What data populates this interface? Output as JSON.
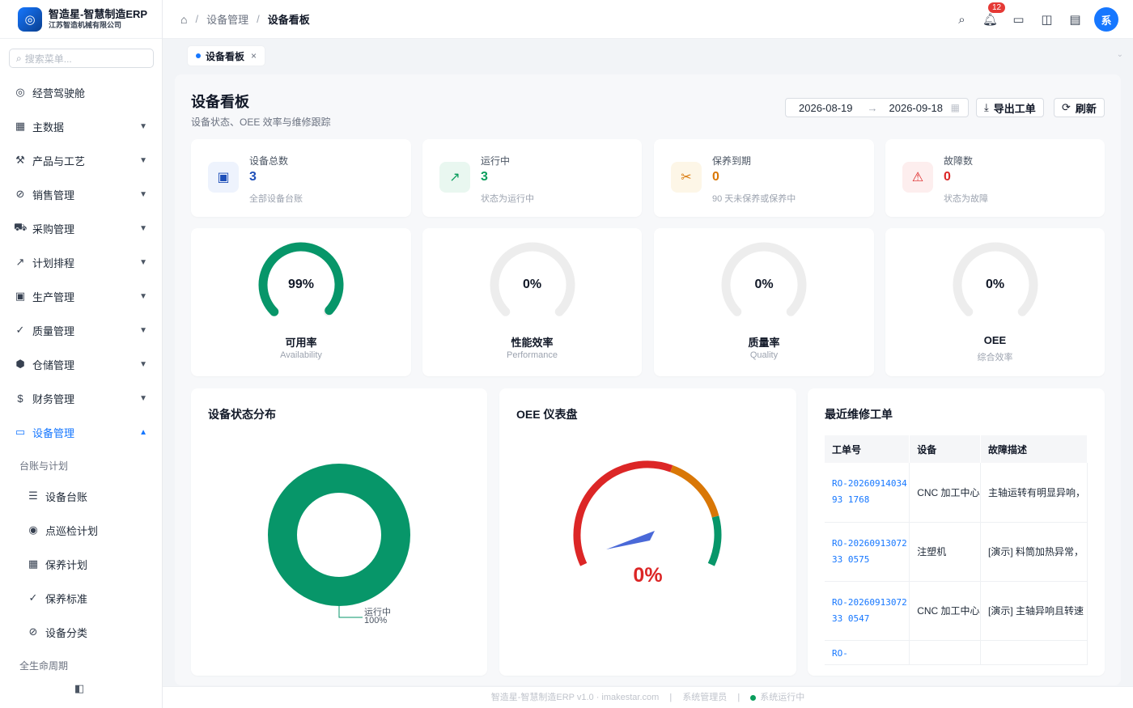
{
  "app": {
    "title": "智造星-智慧制造ERP",
    "company": "江苏智造机械有限公司",
    "logo_glyph": "◎"
  },
  "search": {
    "placeholder": "搜索菜单..."
  },
  "sidebar": {
    "items": [
      {
        "label": "经营驾驶舱",
        "icon": "◎"
      },
      {
        "label": "主数据",
        "icon": "▦"
      },
      {
        "label": "产品与工艺",
        "icon": "⚒"
      },
      {
        "label": "销售管理",
        "icon": "⊘"
      },
      {
        "label": "采购管理",
        "icon": "⛟"
      },
      {
        "label": "计划排程",
        "icon": "↗"
      },
      {
        "label": "生产管理",
        "icon": "▣"
      },
      {
        "label": "质量管理",
        "icon": "✓"
      },
      {
        "label": "仓储管理",
        "icon": "⬢"
      },
      {
        "label": "财务管理",
        "icon": "$"
      },
      {
        "label": "设备管理",
        "icon": "▭"
      }
    ],
    "group1": "台账与计划",
    "subitems": [
      {
        "label": "设备台账",
        "icon": "☰"
      },
      {
        "label": "点巡检计划",
        "icon": "◉"
      },
      {
        "label": "保养计划",
        "icon": "▦"
      },
      {
        "label": "保养标准",
        "icon": "✓"
      },
      {
        "label": "设备分类",
        "icon": "⊘"
      }
    ],
    "group2": "全生命周期"
  },
  "header": {
    "breadcrumb": [
      "设备管理",
      "设备看板"
    ],
    "notification_count": "12",
    "avatar": "系"
  },
  "tab": {
    "label": "设备看板",
    "close": "×"
  },
  "page": {
    "title": "设备看板",
    "subtitle": "设备状态、OEE 效率与维修跟踪"
  },
  "toolbar": {
    "date_start": "2026-08-19",
    "date_end": "2026-09-18",
    "export_label": "导出工单",
    "refresh_label": "刷新"
  },
  "kpis": [
    {
      "label": "设备总数",
      "value": "3",
      "desc": "全部设备台账",
      "color": "#1e4fb8",
      "bg": "#eef3fd",
      "icon": "▣"
    },
    {
      "label": "运行中",
      "value": "3",
      "desc": "状态为运行中",
      "color": "#0a9d5c",
      "bg": "#e9f7f0",
      "icon": "↗"
    },
    {
      "label": "保养到期",
      "value": "0",
      "desc": "90 天未保养或保养中",
      "color": "#d97706",
      "bg": "#fdf6e7",
      "icon": "✂"
    },
    {
      "label": "故障数",
      "value": "0",
      "desc": "状态为故障",
      "color": "#dc2626",
      "bg": "#fdeeee",
      "icon": "⚠"
    }
  ],
  "gauges": [
    {
      "value_pct": 99,
      "label": "99%",
      "name": "可用率",
      "en": "Availability"
    },
    {
      "value_pct": 0,
      "label": "0%",
      "name": "性能效率",
      "en": "Performance"
    },
    {
      "value_pct": 0,
      "label": "0%",
      "name": "质量率",
      "en": "Quality"
    },
    {
      "value_pct": 0,
      "label": "0%",
      "name": "OEE",
      "en": "综合效率"
    }
  ],
  "status_chart": {
    "title": "设备状态分布",
    "chart_data": {
      "type": "pie",
      "categories": [
        "运行中"
      ],
      "values": [
        100
      ],
      "labels": [
        "100%"
      ],
      "colors": [
        "#079669"
      ]
    }
  },
  "oee_panel": {
    "title": "OEE 仪表盘",
    "value_pct": 0,
    "label": "0%"
  },
  "repairs": {
    "title": "最近维修工单",
    "columns": [
      "工单号",
      "设备",
      "故障描述"
    ],
    "rows": [
      {
        "code": "RO-2026091403493 1768",
        "equipment": "CNC 加工中心",
        "desc": "主轴运转有明显异响，"
      },
      {
        "code": "RO-2026091307233 0575",
        "equipment": "注塑机",
        "desc": "[演示] 料筒加热异常，"
      },
      {
        "code": "RO-2026091307233 0547",
        "equipment": "CNC 加工中心",
        "desc": "[演示] 主轴异响且转速"
      },
      {
        "code": "RO-",
        "equipment": "",
        "desc": ""
      }
    ]
  },
  "footer": {
    "copyright": "智造星-智慧制造ERP v1.0 · imakestar.com",
    "user": "系统管理员",
    "status": "系统运行中"
  },
  "colors": {
    "accent": "#1677ff",
    "green": "#079669",
    "red": "#dc2626",
    "orange": "#d97706"
  }
}
